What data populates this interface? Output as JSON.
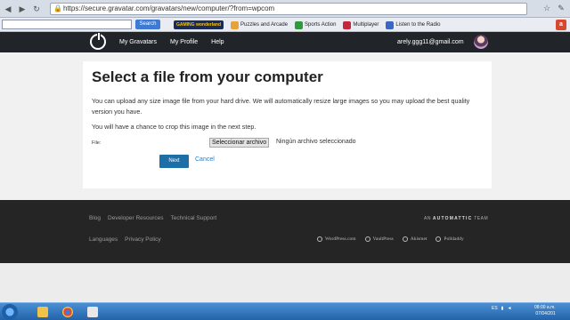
{
  "browser": {
    "url": "https://secure.gravatar.com/gravatars/new/computer/?from=wpcom",
    "nav_icons": [
      "back-icon",
      "forward-icon",
      "reload-icon",
      "home-icon"
    ],
    "window_icons": [
      "star-icon",
      "wrench-icon"
    ]
  },
  "toolbar": {
    "search_button": "Search",
    "logo_text": "GAMING wonderland",
    "items": [
      "Puzzles and Arcade",
      "Sports Action",
      "Multiplayer",
      "Listen to the Radio"
    ]
  },
  "header": {
    "nav": [
      "My Gravatars",
      "My Profile",
      "Help"
    ],
    "user_email": "arely.ggg11@gmail.com"
  },
  "main": {
    "title": "Select a file from your computer",
    "paragraph1": "You can upload any size image file from your hard drive. We will automatically resize large images so you may upload the best quality version you have.",
    "paragraph2": "You will have a chance to crop this image in the next step.",
    "file_label": "File:",
    "file_button": "Seleccionar archivo",
    "file_status": "Ningún archivo seleccionado",
    "next_button": "Next",
    "cancel_link": "Cancel"
  },
  "footer": {
    "links_row1": [
      "Blog",
      "Developer Resources",
      "Technical Support"
    ],
    "links_row2": [
      "Languages",
      "Privacy Policy"
    ],
    "automattic_prefix": "AN",
    "automattic_name": "AUTOMATTIC",
    "automattic_suffix": "TEAM",
    "brands": [
      "WordPress.com",
      "VaultPress",
      "Akismet",
      "Polldaddy"
    ]
  },
  "taskbar": {
    "language": "ES",
    "time": "08:00 a.m.",
    "date": "07/04/201"
  },
  "colors": {
    "header_bg": "#21252a",
    "footer_bg": "#252525",
    "primary_button": "#1e6fa8",
    "link": "#2a7dbf"
  }
}
